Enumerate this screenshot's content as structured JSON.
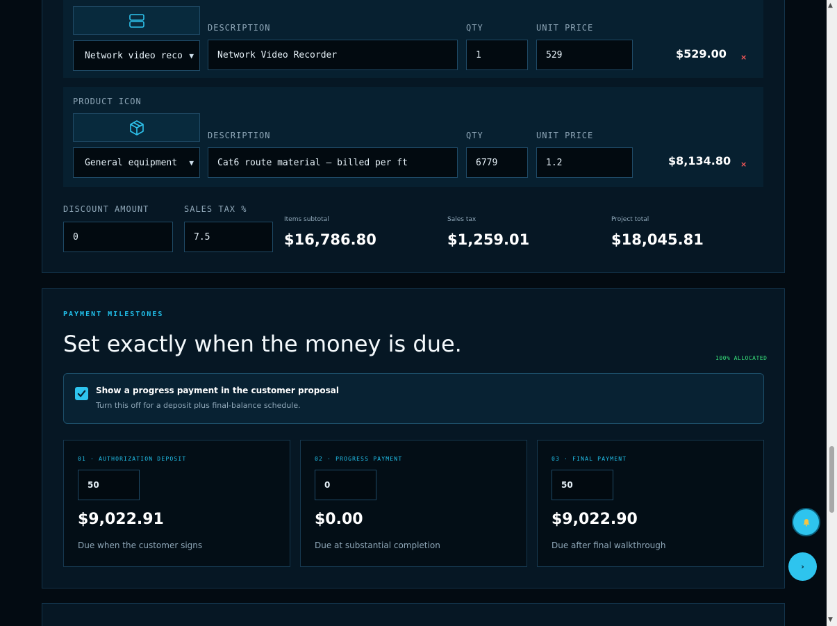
{
  "line_items": [
    {
      "icon": "server-icon",
      "category": "Network video reco",
      "description_label": "DESCRIPTION",
      "description": "Network Video Recorder",
      "qty_label": "QTY",
      "qty": "1",
      "unit_price_label": "UNIT PRICE",
      "unit_price": "529",
      "line_total": "$529.00",
      "remove": "×"
    },
    {
      "product_icon_label": "PRODUCT ICON",
      "icon": "box-icon",
      "category": "General equipment",
      "description_label": "DESCRIPTION",
      "description": "Cat6 route material — billed per ft",
      "qty_label": "QTY",
      "qty": "6779",
      "unit_price_label": "UNIT PRICE",
      "unit_price": "1.2",
      "line_total": "$8,134.80",
      "remove": "×"
    }
  ],
  "totals": {
    "discount_label": "DISCOUNT AMOUNT",
    "discount": "0",
    "tax_label": "SALES TAX %",
    "tax": "7.5",
    "items_subtotal_label": "Items subtotal",
    "items_subtotal": "$16,786.80",
    "sales_tax_label": "Sales tax",
    "sales_tax": "$1,259.01",
    "project_total_label": "Project total",
    "project_total": "$18,045.81"
  },
  "milestones_section": {
    "eyebrow": "PAYMENT MILESTONES",
    "headline": "Set exactly when the money is due.",
    "allocated": "100% ALLOCATED",
    "toggle": {
      "checked": true,
      "title": "Show a progress payment in the customer proposal",
      "subtitle": "Turn this off for a deposit plus final-balance schedule."
    },
    "milestones": [
      {
        "label": "01 · AUTHORIZATION DEPOSIT",
        "percent": "50",
        "amount": "$9,022.91",
        "note": "Due when the customer signs"
      },
      {
        "label": "02 · PROGRESS PAYMENT",
        "percent": "0",
        "amount": "$0.00",
        "note": "Due at substantial completion"
      },
      {
        "label": "03 · FINAL PAYMENT",
        "percent": "50",
        "amount": "$9,022.90",
        "note": "Due after final walkthrough"
      }
    ]
  },
  "floating": {
    "bell_icon": "bell-icon",
    "next_icon": "chevron-right-icon",
    "next_glyph": "›"
  },
  "colors": {
    "background": "#030b12",
    "panel": "#061724",
    "accent": "#2ec4ee",
    "allocated": "#38e07b",
    "remove": "#ff5a5a"
  }
}
